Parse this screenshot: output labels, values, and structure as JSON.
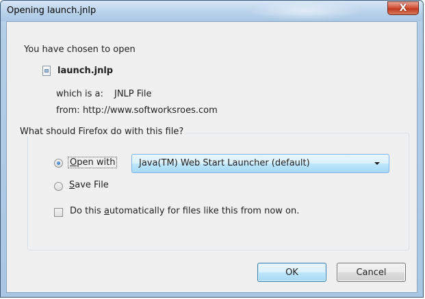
{
  "window": {
    "title": "Opening launch.jnlp",
    "close_glyph": "X"
  },
  "intro": "You have chosen to open",
  "file": {
    "icon": "file-icon",
    "name": "launch.jnlp",
    "type_label": "which is a:",
    "type_value": "JNLP File",
    "from_label": "from:",
    "from_value": "http://www.softworksroes.com"
  },
  "action_group": {
    "legend": "What should Firefox do with this file?",
    "open_with": {
      "label_pre": "",
      "label_key": "O",
      "label_post": "pen with",
      "checked": true
    },
    "open_with_app": "Java(TM) Web Start Launcher (default)",
    "save_file": {
      "label_key": "S",
      "label_post": "ave File",
      "checked": false
    },
    "auto": {
      "label_pre": "Do this ",
      "label_key": "a",
      "label_post": "utomatically for files like this from now on.",
      "checked": false
    }
  },
  "buttons": {
    "ok": "OK",
    "cancel": "Cancel"
  }
}
